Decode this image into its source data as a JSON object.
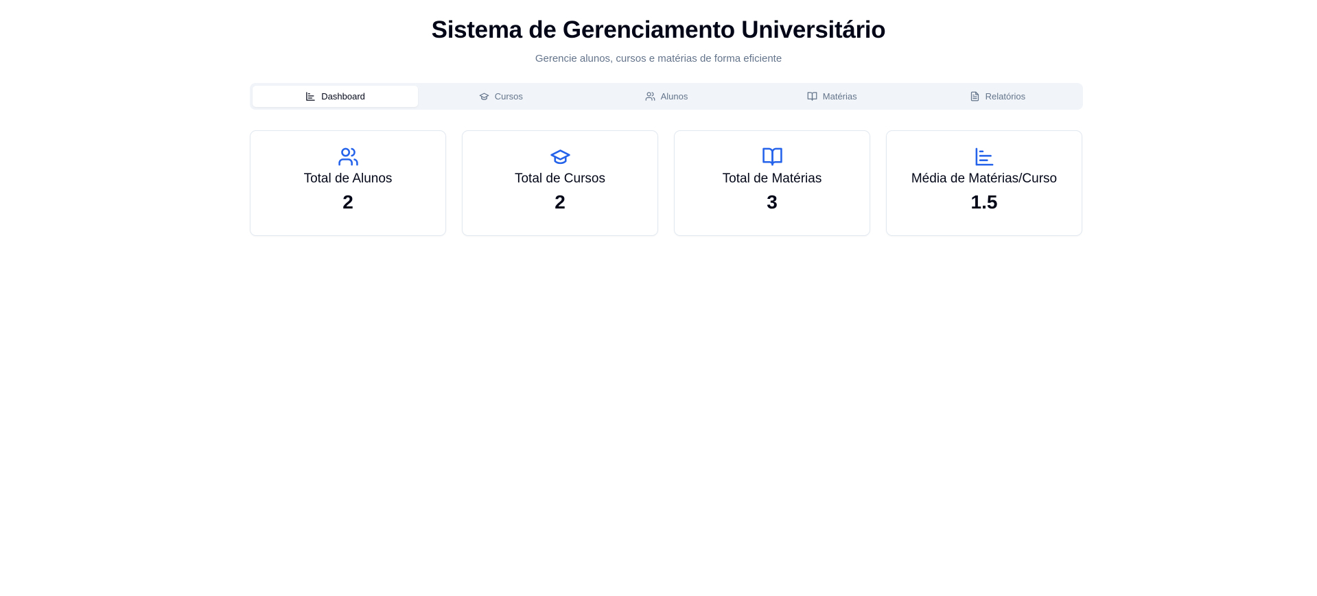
{
  "header": {
    "title": "Sistema de Gerenciamento Universitário",
    "subtitle": "Gerencie alunos, cursos e matérias de forma eficiente"
  },
  "tabs": [
    {
      "label": "Dashboard",
      "icon": "bar-chart-icon",
      "active": true
    },
    {
      "label": "Cursos",
      "icon": "graduation-cap-icon",
      "active": false
    },
    {
      "label": "Alunos",
      "icon": "users-icon",
      "active": false
    },
    {
      "label": "Matérias",
      "icon": "book-open-icon",
      "active": false
    },
    {
      "label": "Relatórios",
      "icon": "file-text-icon",
      "active": false
    }
  ],
  "cards": [
    {
      "label": "Total de Alunos",
      "value": "2",
      "icon": "users-icon"
    },
    {
      "label": "Total de Cursos",
      "value": "2",
      "icon": "graduation-cap-icon"
    },
    {
      "label": "Total de Matérias",
      "value": "3",
      "icon": "book-open-icon"
    },
    {
      "label": "Média de Matérias/Curso",
      "value": "1.5",
      "icon": "bar-chart-icon"
    }
  ],
  "colors": {
    "accent": "#2563eb",
    "tab_bar_bg": "#f1f5f9",
    "muted_text": "#64748b",
    "card_border": "#e2e8f0"
  }
}
